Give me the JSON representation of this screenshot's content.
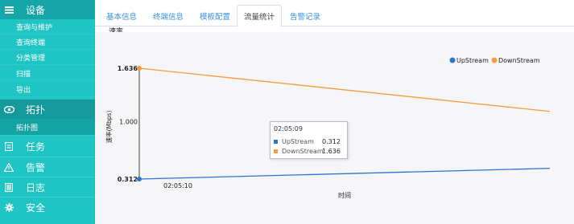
{
  "sidebar": {
    "device": {
      "label": "设备",
      "icon": "device-icon"
    },
    "device_items": [
      "查询与维护",
      "查询终端",
      "分类管理",
      "扫描",
      "导出"
    ],
    "topology": {
      "label": "拓扑",
      "icon": "eye-icon"
    },
    "topology_items": [
      "拓扑图"
    ],
    "sections": [
      {
        "label": "任务",
        "icon": "task-icon"
      },
      {
        "label": "告警",
        "icon": "warning-icon"
      },
      {
        "label": "日志",
        "icon": "log-icon"
      },
      {
        "label": "安全",
        "icon": "gear-icon"
      }
    ]
  },
  "tabs": [
    {
      "label": "基本信息",
      "active": false
    },
    {
      "label": "终端信息",
      "active": false
    },
    {
      "label": "模板配置",
      "active": false
    },
    {
      "label": "流量统计",
      "active": true
    },
    {
      "label": "告警记录",
      "active": false
    }
  ],
  "chart_title": "速率",
  "chart_data": {
    "type": "line",
    "ylabel": "速率(Mbps)",
    "xlabel": "时间",
    "y_tick_labels": [
      "0.312",
      "1.000",
      "1.636"
    ],
    "x_tick_labels": [
      "02:05:10"
    ],
    "x_first": "02:05:09",
    "series": [
      {
        "name": "UpStream",
        "color": "#2e75c6",
        "start": 0.312,
        "end": 0.44
      },
      {
        "name": "DownStream",
        "color": "#f39c3c",
        "start": 1.636,
        "end": 1.12
      }
    ],
    "legend_position": "top-right",
    "grid": false
  },
  "tooltip": {
    "time": "02:05:09",
    "rows": [
      {
        "name": "UpStream",
        "value": "0.312",
        "color": "#2e75c6"
      },
      {
        "name": "DownStream",
        "value": "1.636",
        "color": "#f39c3c"
      }
    ]
  }
}
